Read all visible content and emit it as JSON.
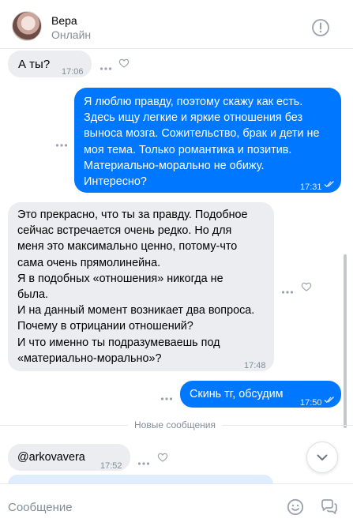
{
  "header": {
    "name": "Вера",
    "status": "Онлайн"
  },
  "messages": [
    {
      "direction": "in",
      "text": "А ты?",
      "time": "17:06"
    },
    {
      "direction": "out",
      "text": "Я люблю правду, поэтому скажу как есть.\nЗдесь ищу легкие и яркие отношения без\nвыноса мозга. Сожительство, брак и дети не\nмоя тема. Только романтика и позитив.\nМатериально-морально не обижу.\nИнтересно?",
      "time": "17:31",
      "read": true
    },
    {
      "direction": "in",
      "text": "Это прекрасно, что ты за правду. Подобное\nсейчас встречается очень редко. Но для\nменя это максимально ценно, потому-что\nсама очень прямолинейна.\nЯ в подобных «отношения» никогда не\nбыла.\nИ на данный момент возникает два вопроса.\nПочему в отрицании отношений?\nИ что именно ты подразумеваешь под\n«материально-морально»?",
      "time": "17:48"
    },
    {
      "direction": "out",
      "text": "Скинь тг, обсудим",
      "time": "17:50",
      "read": true
    },
    {
      "direction": "in",
      "text": "@arkovavera",
      "time": "17:52"
    }
  ],
  "divider": {
    "label": "Новые сообщения"
  },
  "composer": {
    "placeholder": "Сообщение"
  },
  "icons": {
    "info": "info-circle-icon",
    "more": "more-dots-icon",
    "like": "heart-icon",
    "read": "double-check-icon",
    "scroll": "chevron-down-icon",
    "emoji": "smile-icon",
    "chats": "chat-bubbles-icon"
  },
  "colors": {
    "accent": "#0077ff",
    "incoming_bubble": "#ebedf0",
    "secondary_text": "#818c99"
  }
}
